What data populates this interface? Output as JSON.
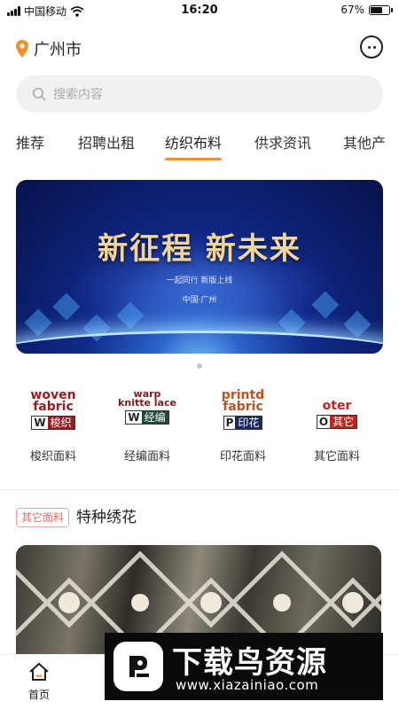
{
  "status_bar": {
    "carrier": "中国移动",
    "time": "16:20",
    "battery": "67%",
    "battery_level": 0.67
  },
  "header": {
    "city": "广州市"
  },
  "search": {
    "placeholder": "搜索内容"
  },
  "tabs": [
    {
      "label": "推荐"
    },
    {
      "label": "招聘出租"
    },
    {
      "label": "纺织布料",
      "active": true
    },
    {
      "label": "供求资讯"
    },
    {
      "label": "其他产"
    }
  ],
  "banner": {
    "title": "新征程 新未来",
    "subtitle": "一起同行 新版上线",
    "location": "中国·广州"
  },
  "categories": [
    {
      "logo_en": "woven fabric",
      "logo_letter": "W",
      "logo_zh": "梭织",
      "color": "#9b1c1c",
      "label": "梭织面料"
    },
    {
      "logo_en": "warp knitte lace",
      "logo_letter": "W",
      "logo_zh": "经编",
      "color": "#1d4a3c",
      "label": "经编面料"
    },
    {
      "logo_en": "printd fabric",
      "logo_letter": "P",
      "logo_zh": "印花",
      "color": "#1a2a5c",
      "label": "印花面料"
    },
    {
      "logo_en": "oter",
      "logo_letter": "O",
      "logo_zh": "其它",
      "color": "#c0241c",
      "label": "其它面料"
    }
  ],
  "section": {
    "tag": "其它面料",
    "title": "特种绣花"
  },
  "bottom_nav": {
    "home_label": "首页"
  },
  "watermark": {
    "title": "下载鸟资源",
    "url": "www.xiazainiao.com"
  },
  "colors": {
    "accent": "#f0912f",
    "tag": "#e86a6a"
  }
}
